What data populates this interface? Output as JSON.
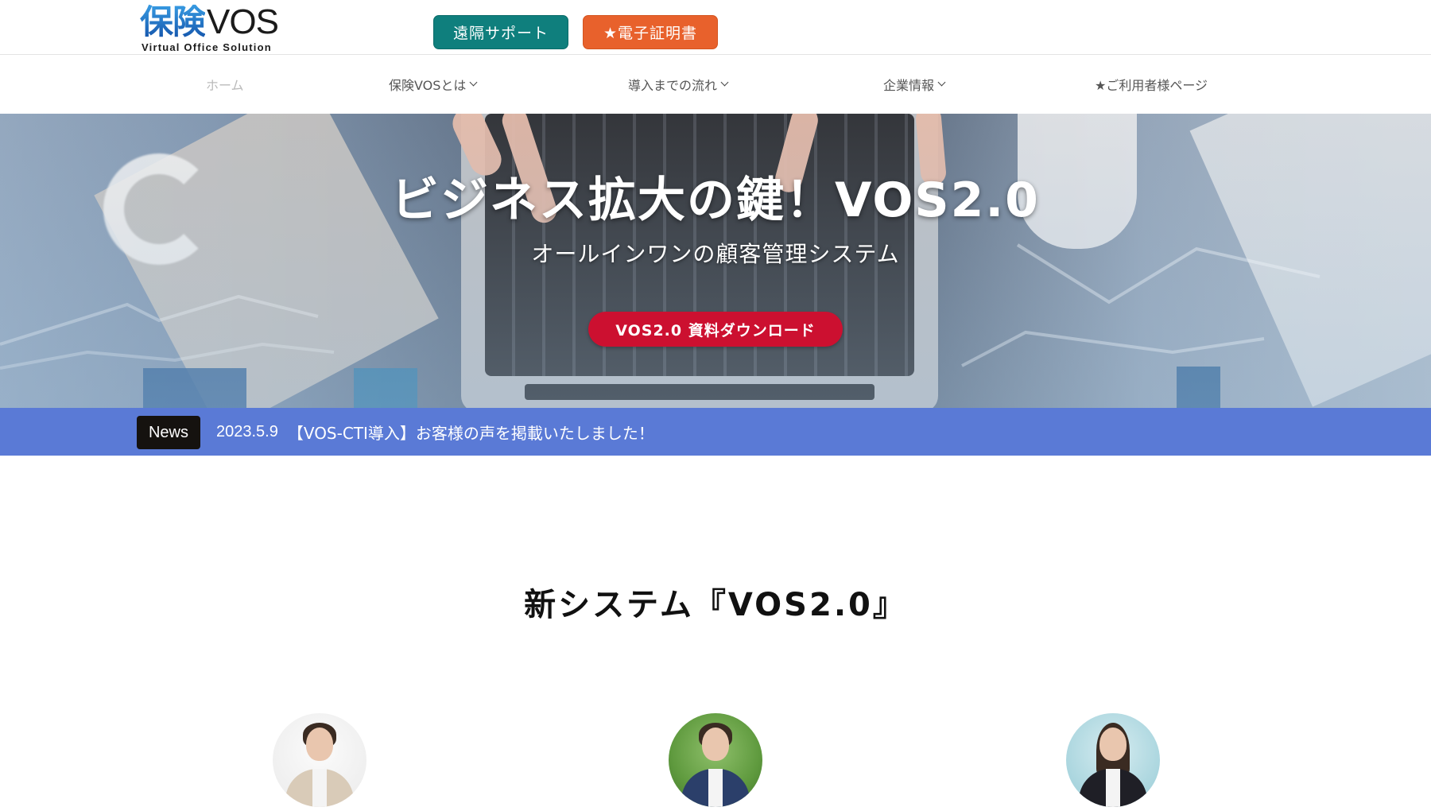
{
  "header": {
    "logo_jp": "保険",
    "logo_en": "VOS",
    "logo_sub": "Virtual Office Solution",
    "remote_support_button": "遠隔サポート",
    "e_certificate_button": "★電子証明書",
    "colors": {
      "remote_support": "#0f7f7d",
      "e_certificate": "#e8612c"
    }
  },
  "nav": {
    "items": [
      {
        "label": "ホーム",
        "dropdown": false,
        "active": true
      },
      {
        "label": "保険VOSとは",
        "dropdown": true
      },
      {
        "label": "導入までの流れ",
        "dropdown": true
      },
      {
        "label": "企業情報",
        "dropdown": true
      },
      {
        "label": "★ご利用者様ページ",
        "dropdown": false
      }
    ]
  },
  "hero": {
    "title": "ビジネス拡大の鍵！VOS2.0",
    "subtitle": "オールインワンの顧客管理システム",
    "cta_button": "VOS2.0 資料ダウンロード",
    "cta_color": "#cc1030"
  },
  "news": {
    "badge": "News",
    "date": "2023.5.9",
    "headline": "【VOS-CTI導入】お客様の声を掲載いたしました！",
    "bar_color": "#5a7ad6"
  },
  "section": {
    "title": "新システム『VOS2.0』",
    "avatars": [
      {
        "name": "woman-ok-gesture"
      },
      {
        "name": "man-with-smartphone"
      },
      {
        "name": "woman-with-headset"
      }
    ]
  }
}
